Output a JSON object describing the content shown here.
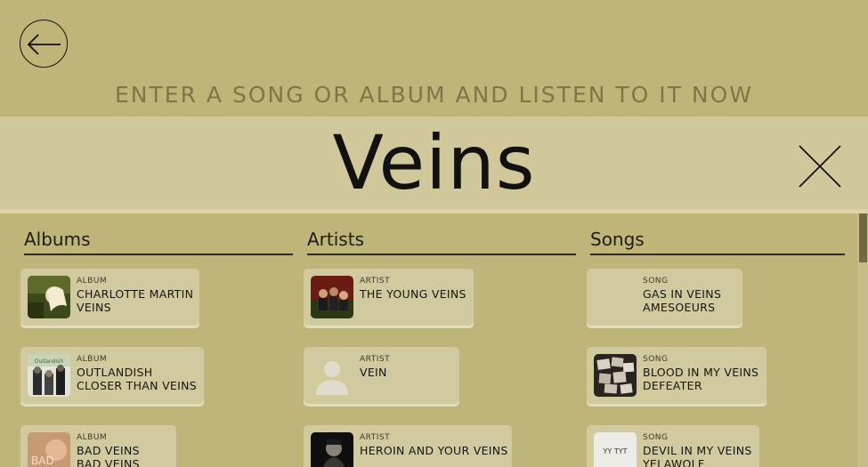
{
  "prompt": "ENTER A SONG OR ALBUM AND LISTEN TO IT NOW",
  "search": {
    "query": "Veins"
  },
  "icons": {
    "back": "arrow-left-icon",
    "clear": "close-icon",
    "artist_placeholder": "person-silhouette-icon"
  },
  "colors": {
    "background": "#bfb578",
    "search_band": "#d0c79b",
    "card": "#d2ca9f",
    "prompt_text": "#7f7647"
  },
  "columns": {
    "albums": {
      "header": "Albums",
      "items": [
        {
          "kind": "ALBUM",
          "line1": "CHARLOTTE MARTIN",
          "line2": "VEINS"
        },
        {
          "kind": "ALBUM",
          "line1": "OUTLANDISH",
          "line2": "CLOSER THAN VEINS"
        },
        {
          "kind": "ALBUM",
          "line1": "BAD VEINS",
          "line2": "BAD VEINS"
        }
      ]
    },
    "artists": {
      "header": "Artists",
      "items": [
        {
          "kind": "ARTIST",
          "line1": "THE YOUNG VEINS",
          "line2": ""
        },
        {
          "kind": "ARTIST",
          "line1": "VEIN",
          "line2": ""
        },
        {
          "kind": "ARTIST",
          "line1": "HEROIN AND YOUR VEINS",
          "line2": ""
        }
      ]
    },
    "songs": {
      "header": "Songs",
      "items": [
        {
          "kind": "SONG",
          "line1": "GAS IN VEINS",
          "line2": "AMESOEURS"
        },
        {
          "kind": "SONG",
          "line1": "BLOOD IN MY VEINS",
          "line2": "DEFEATER"
        },
        {
          "kind": "SONG",
          "line1": "DEVIL IN MY VEINS",
          "line2": "YELAWOLF"
        }
      ]
    }
  },
  "thumb_texts": {
    "outlandish": "Outlandish",
    "bad_veins": "BAD",
    "devil": "YY\nTYT"
  }
}
